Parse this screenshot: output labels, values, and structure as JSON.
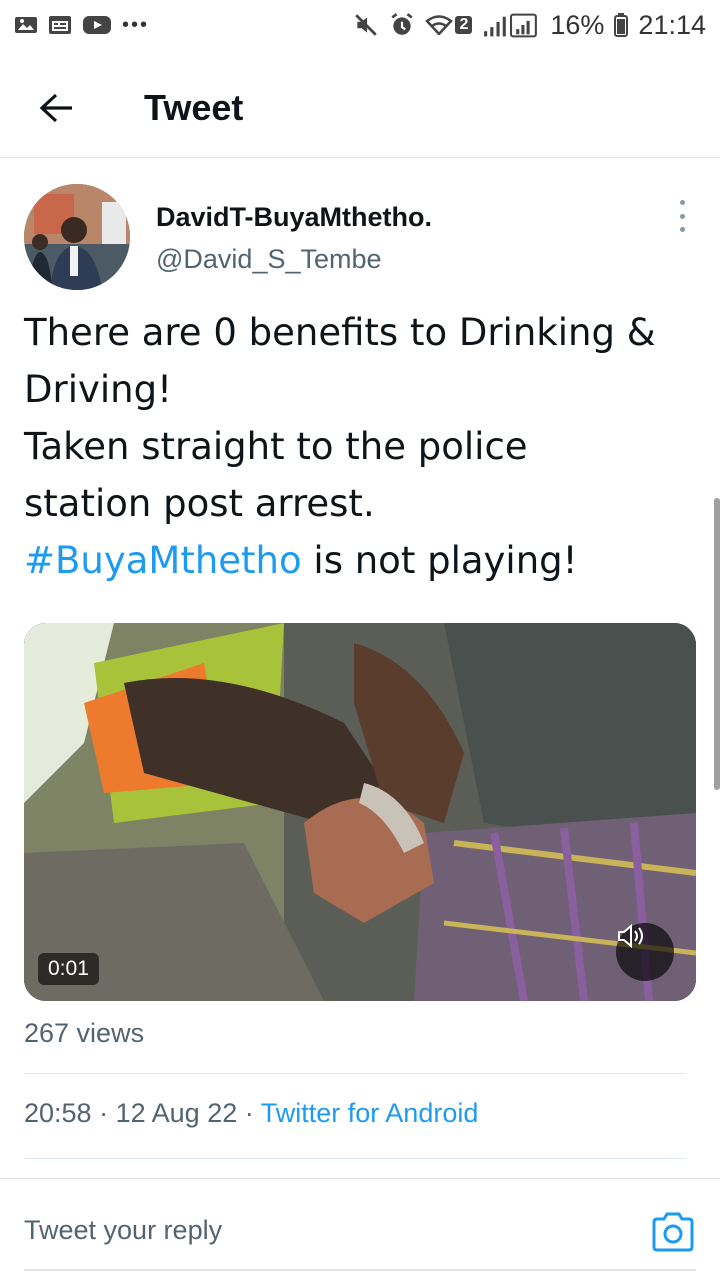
{
  "status_bar": {
    "left_icons": [
      "gallery-icon",
      "calendar-icon",
      "youtube-icon",
      "more-dots-icon"
    ],
    "right_icons": [
      "mute-icon",
      "alarm-icon",
      "wifi-icon",
      "signal-icon"
    ],
    "wifi_badge": "2",
    "battery": "16%",
    "time": "21:14"
  },
  "header": {
    "title": "Tweet"
  },
  "tweet": {
    "display_name": "DavidT-BuyaMthetho.",
    "handle": "@David_S_Tembe",
    "text_lines": [
      "There are 0 benefits to Drinking &",
      "Driving!",
      "Taken straight to the police",
      "station post arrest."
    ],
    "hashtag": "#BuyaMthetho",
    "text_tail": " is not playing!",
    "video": {
      "timecode": "0:01"
    },
    "views": "267 views",
    "time": "20:58",
    "date": "12 Aug 22",
    "separator": "·",
    "source": "Twitter for Android"
  },
  "reply": {
    "placeholder": "Tweet your reply"
  },
  "colors": {
    "accent": "#1d9bf0",
    "secondary_text": "#536471",
    "primary_text": "#0f1419"
  }
}
